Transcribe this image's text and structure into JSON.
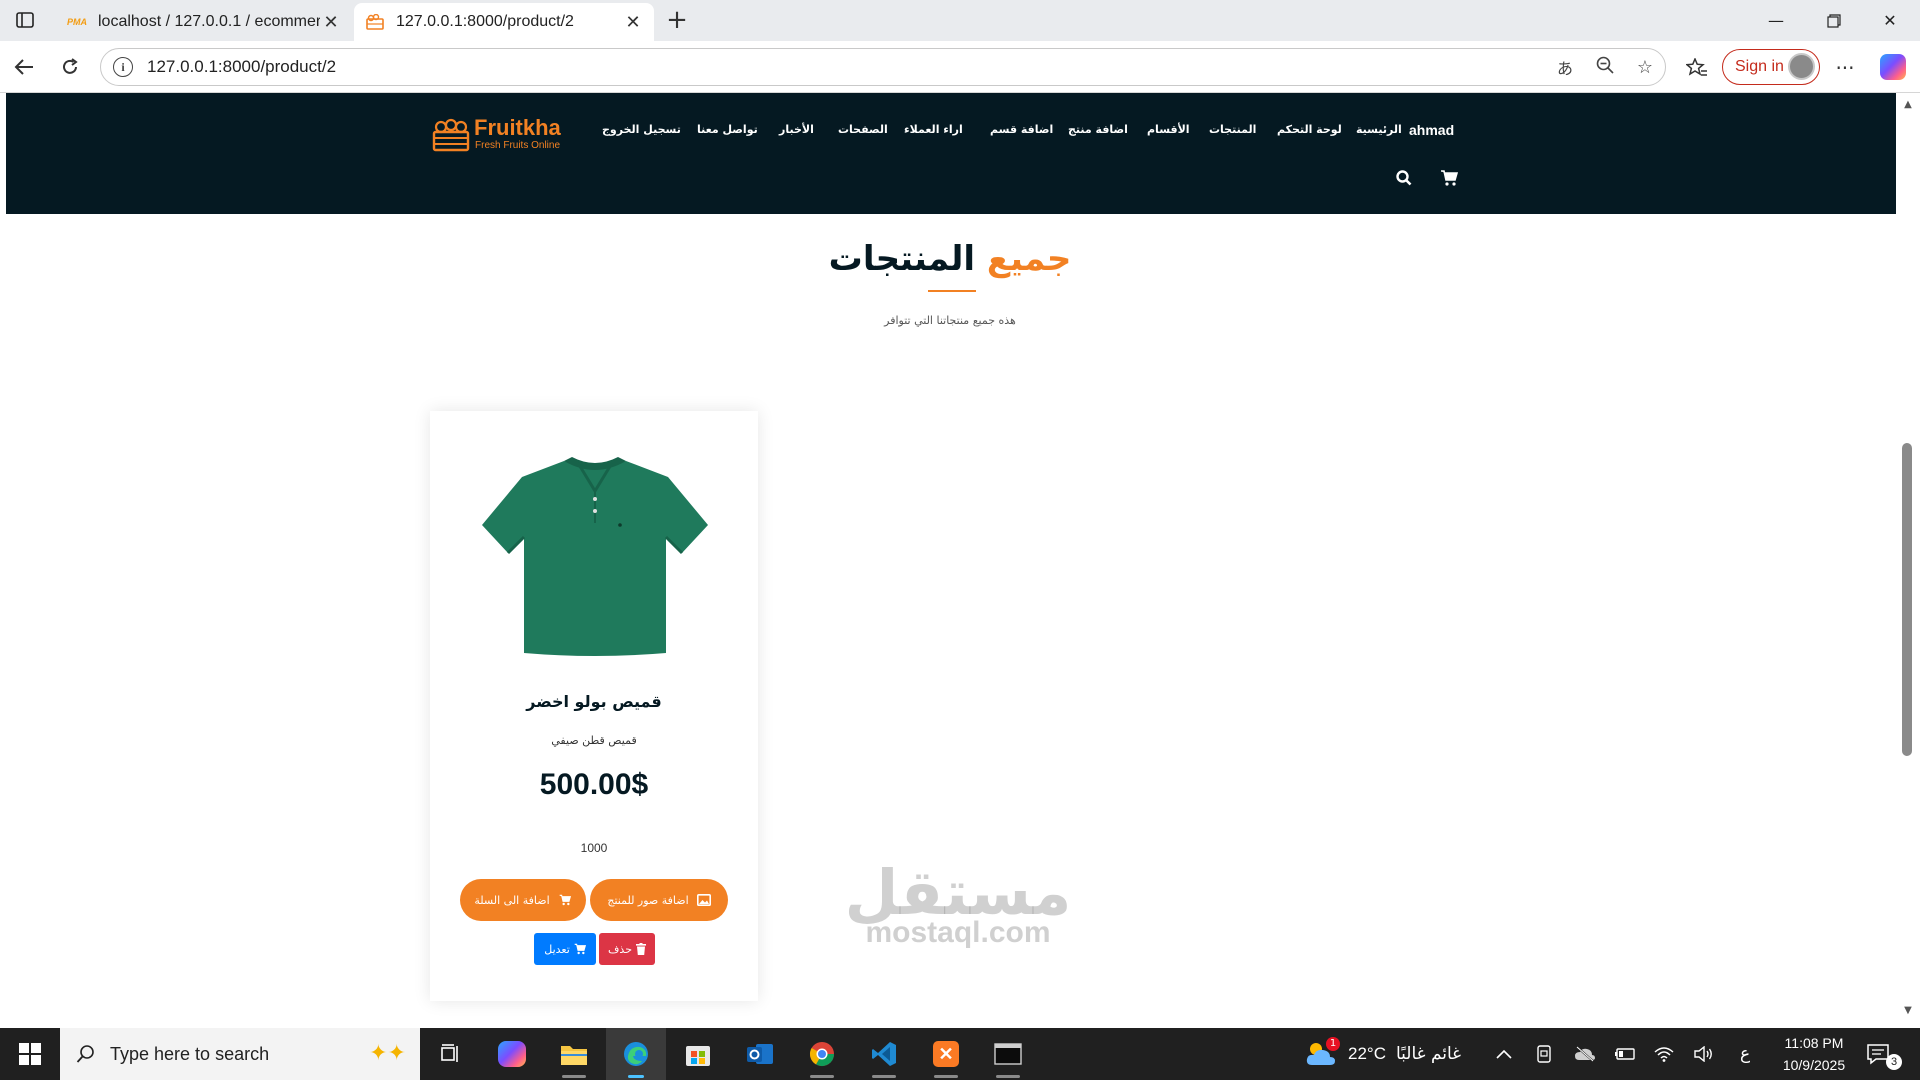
{
  "browser": {
    "tabs": [
      {
        "title": "localhost / 127.0.0.1 / ecommerce",
        "favicon": "phpmyadmin-icon",
        "active": false
      },
      {
        "title": "127.0.0.1:8000/product/2",
        "favicon": "fruitkha-icon",
        "active": true
      }
    ],
    "url": "127.0.0.1:8000/product/2",
    "signin_label": "Sign in",
    "favicon_pma_text": "PMA"
  },
  "site": {
    "brand": "Fruitkha",
    "tagline": "Fresh Fruits Online",
    "user": "ahmad",
    "nav": [
      "الرئيسية",
      "لوحة التحكم",
      "المنتجات",
      "الأقسام",
      "اضافة منتج",
      "اضافة قسم",
      "اراء العملاء",
      "الصفحات",
      "الأخبار",
      "تواصل معنا",
      "تسجيل الخروج"
    ]
  },
  "section": {
    "title_orange": "جميع",
    "title_dark": "المنتجات",
    "subtitle": "هذه جميع منتجاتنا التي تتوافر"
  },
  "product": {
    "name": "قميص بولو اخضر",
    "description": "قميص قطن صيفي",
    "price": "500.00$",
    "quantity": "1000",
    "shirt_color": "#1f7a5c",
    "buttons": {
      "add_images": "اضافة صور للمنتج",
      "add_to_cart": "اضافة الى السلة",
      "delete": "حذف",
      "edit": "تعديل"
    }
  },
  "watermark": {
    "arabic": "مستقل",
    "latin": "mostaql.com"
  },
  "taskbar": {
    "search_placeholder": "Type here to search",
    "apps": [
      "task-view-icon",
      "copilot-icon",
      "file-explorer-icon",
      "edge-icon",
      "store-icon",
      "outlook-icon",
      "chrome-icon",
      "vscode-icon",
      "xampp-icon",
      "terminal-icon"
    ],
    "weather_temp": "22°C",
    "weather_text": "غائم غالبًا",
    "weather_badge": "1",
    "lang": "ع",
    "time": "11:08 PM",
    "date": "10/9/2025",
    "notifications": "3"
  },
  "colors": {
    "accent": "#f28123",
    "header_bg": "#051922",
    "danger": "#dc3545",
    "primary": "#007bff"
  }
}
